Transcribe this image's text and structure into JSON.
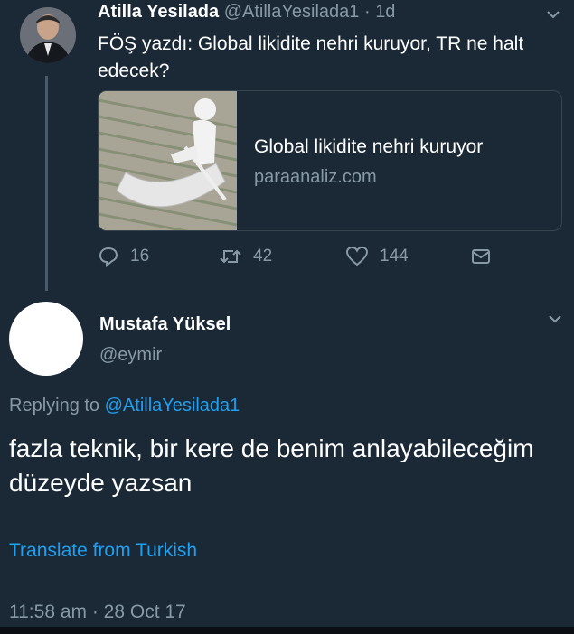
{
  "tweet1": {
    "name": "Atilla Yesilada",
    "handle": "@AtillaYesilada1",
    "separator": "·",
    "age": "1d",
    "text": "FÖŞ yazdı:  Global likidite nehri kuruyor, TR ne halt edecek?",
    "card": {
      "title": "Global likidite nehri kuruyor",
      "domain": "paraanaliz.com"
    },
    "actions": {
      "replies": "16",
      "retweets": "42",
      "likes": "144"
    }
  },
  "tweet2": {
    "name": "Mustafa Yüksel",
    "handle": "@eymir",
    "replying_prefix": "Replying to",
    "replying_to": "@AtillaYesilada1",
    "text": "fazla teknik, bir kere de benim anlayabileceğim düzeyde yazsan",
    "translate_label": "Translate from Turkish",
    "timestamp": "11:58 am · 28 Oct 17"
  },
  "colors": {
    "background": "#1b2836",
    "secondary_text": "#8899a6",
    "link": "#1da1f2",
    "border": "#38444d"
  },
  "icons": [
    "chevron-down-icon",
    "reply-icon",
    "retweet-icon",
    "like-icon",
    "direct-message-icon"
  ]
}
